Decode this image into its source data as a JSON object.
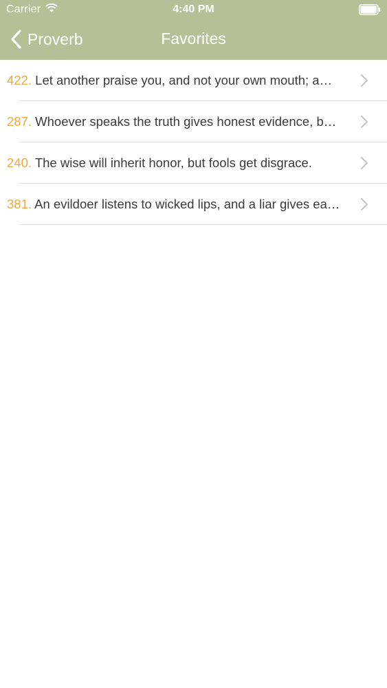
{
  "status_bar": {
    "carrier": "Carrier",
    "time": "4:40 PM",
    "wifi_icon": "wifi-icon",
    "battery_icon": "battery-icon"
  },
  "nav": {
    "back_label": "Proverb",
    "title": "Favorites"
  },
  "favorites": [
    {
      "number": "422.",
      "text": "Let another praise you, and not your own mouth; a…"
    },
    {
      "number": "287.",
      "text": "Whoever speaks the truth gives honest evidence, b…"
    },
    {
      "number": "240.",
      "text": "The wise will inherit honor, but fools get disgrace."
    },
    {
      "number": "381.",
      "text": "An evildoer listens to wicked lips, and a liar gives ear…"
    }
  ],
  "colors": {
    "header_bg": "#b5c096",
    "number_accent": "#eda93f",
    "text": "#3a3a3a",
    "chevron": "#c4c4c9"
  }
}
